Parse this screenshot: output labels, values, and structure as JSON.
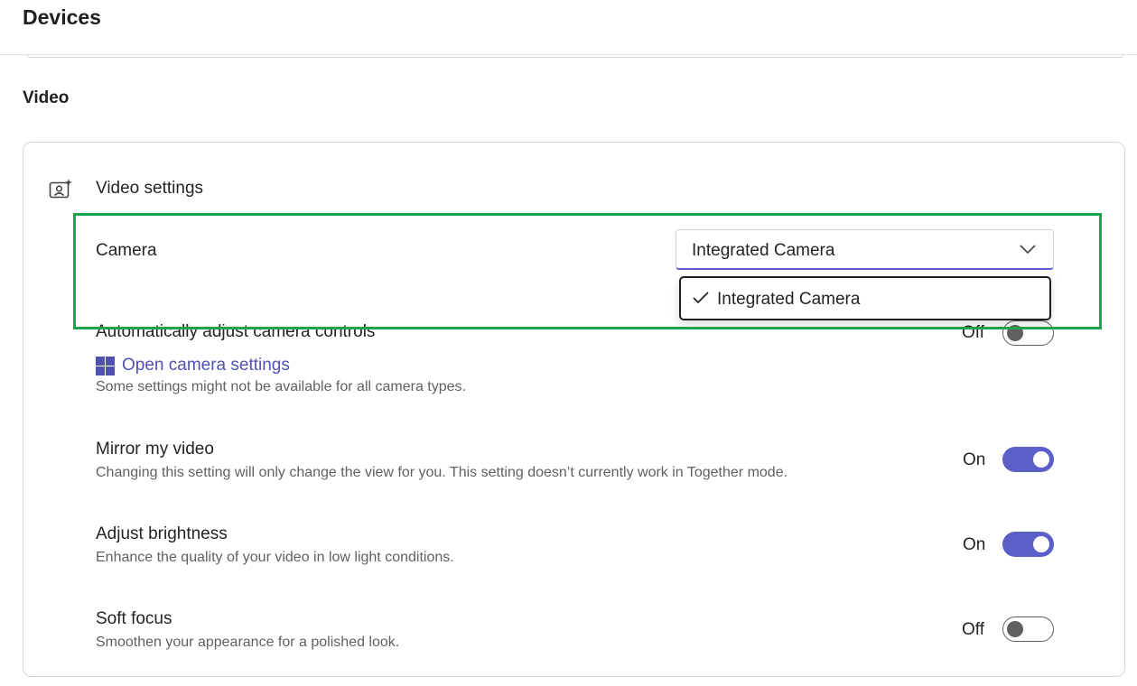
{
  "header": {
    "title": "Devices"
  },
  "video_section": {
    "title": "Video",
    "card_heading": "Video settings",
    "card_icon": "camera-sparkle-icon"
  },
  "camera": {
    "label": "Camera",
    "selected": "Integrated Camera",
    "options": [
      {
        "label": "Integrated Camera",
        "checked": true
      }
    ]
  },
  "auto_adjust": {
    "label": "Automatically adjust camera controls",
    "state_label": "Off",
    "on": false,
    "link_text": "Open camera settings",
    "link_icon": "windows-icon",
    "description": "Some settings might not be available for all camera types."
  },
  "mirror": {
    "label": "Mirror my video",
    "description": "Changing this setting will only change the view for you. This setting doesn’t currently work in Together mode.",
    "state_label": "On",
    "on": true
  },
  "brightness": {
    "label": "Adjust brightness",
    "description": "Enhance the quality of your video in low light conditions.",
    "state_label": "On",
    "on": true
  },
  "soft_focus": {
    "label": "Soft focus",
    "description": "Smoothen your appearance for a polished look.",
    "state_label": "Off",
    "on": false
  },
  "colors": {
    "accent": "#5b5fc7",
    "link": "#4f52b2",
    "highlight": "#1ea34a"
  }
}
